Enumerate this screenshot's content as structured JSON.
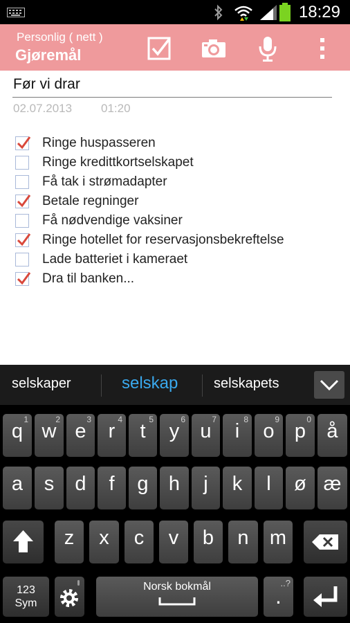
{
  "status_bar": {
    "time": "18:29"
  },
  "app_bar": {
    "subtitle": "Personlig ( nett )",
    "title": "Gjøremål"
  },
  "note": {
    "title": "Før vi drar",
    "date": "02.07.2013",
    "time": "01:20",
    "items": [
      {
        "label": "Ringe huspasseren",
        "checked": true
      },
      {
        "label": "Ringe kredittkortselskapet",
        "checked": false
      },
      {
        "label": "Få tak i strømadapter",
        "checked": false
      },
      {
        "label": "Betale regninger",
        "checked": true
      },
      {
        "label": "Få nødvendige vaksiner",
        "checked": false
      },
      {
        "label": "Ringe hotellet for reservasjonsbekreftelse",
        "checked": true
      },
      {
        "label": "Lade batteriet i kameraet",
        "checked": false
      },
      {
        "label": "Dra til banken...",
        "checked": true
      }
    ]
  },
  "suggestions": [
    "selskaper",
    "selskap",
    "selskapets"
  ],
  "keyboard": {
    "row1": [
      {
        "l": "q",
        "n": "1"
      },
      {
        "l": "w",
        "n": "2"
      },
      {
        "l": "e",
        "n": "3"
      },
      {
        "l": "r",
        "n": "4"
      },
      {
        "l": "t",
        "n": "5"
      },
      {
        "l": "y",
        "n": "6"
      },
      {
        "l": "u",
        "n": "7"
      },
      {
        "l": "i",
        "n": "8"
      },
      {
        "l": "o",
        "n": "9"
      },
      {
        "l": "p",
        "n": "0"
      },
      {
        "l": "å",
        "n": ""
      }
    ],
    "row2": [
      "a",
      "s",
      "d",
      "f",
      "g",
      "h",
      "j",
      "k",
      "l",
      "ø",
      "æ"
    ],
    "row3": [
      "z",
      "x",
      "c",
      "v",
      "b",
      "n",
      "m"
    ],
    "sym_label_1": "123",
    "sym_label_2": "Sym",
    "space_label": "Norsk bokmål",
    "period_label": ".",
    "period_hint": "..?"
  },
  "colors": {
    "accent": "#ef9a9c",
    "check": "#d9483b",
    "suggestion_highlight": "#3aa9ee"
  }
}
